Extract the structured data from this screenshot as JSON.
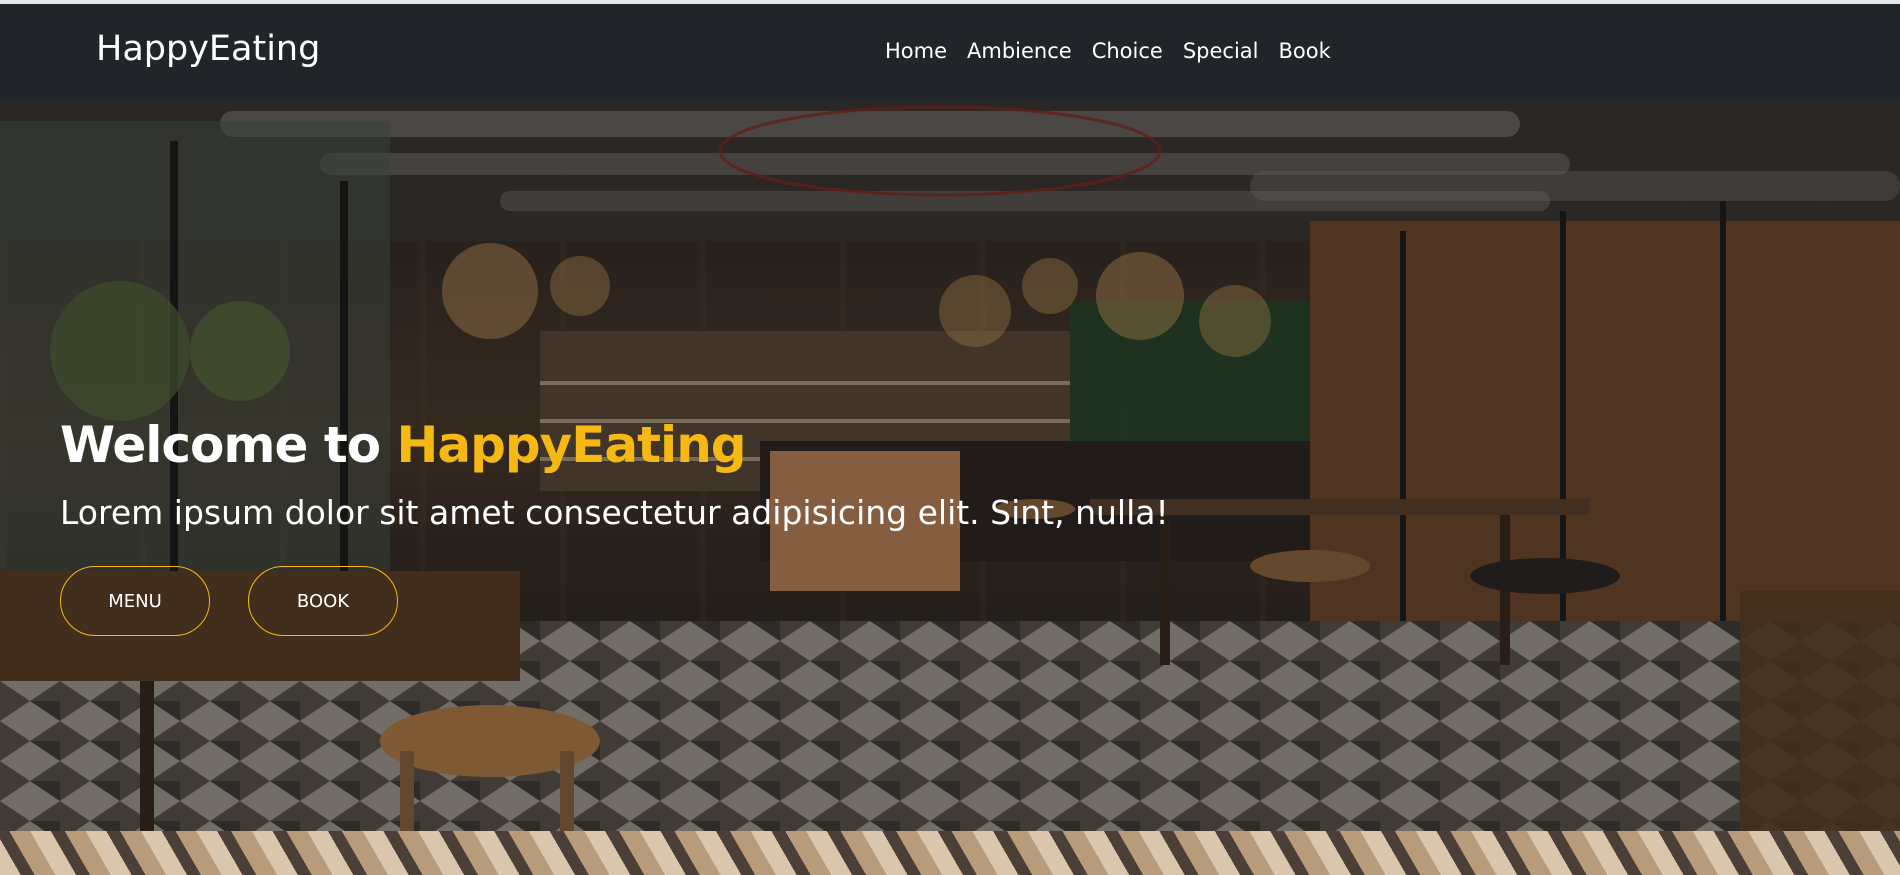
{
  "navbar": {
    "brand": "HappyEating",
    "links": [
      "Home",
      "Ambience",
      "Choice",
      "Special",
      "Book"
    ]
  },
  "hero": {
    "title_prefix": "Welcome to ",
    "title_accent": "HappyEating",
    "subtitle": "Lorem ipsum dolor sit amet consectetur adipisicing elit. Sint, nulla!",
    "buttons": [
      "MENU",
      "BOOK"
    ]
  },
  "colors": {
    "navbar_bg": "#212529",
    "accent": "#f6b913",
    "text": "#ffffff"
  }
}
